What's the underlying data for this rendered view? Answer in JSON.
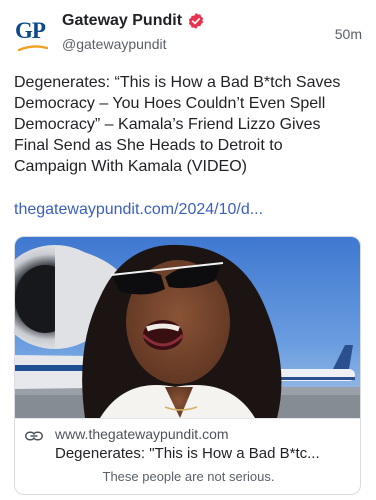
{
  "account": {
    "avatar_text": "GP",
    "display_name": "Gateway Pundit",
    "handle": "@gatewaypundit",
    "verified": true,
    "time_ago": "50m"
  },
  "post": {
    "text": "Degenerates: “This is How a Bad B*tch Saves Democracy – You Hoes Couldn’t Even Spell Democracy” – Kamala’s Friend Lizzo Gives Final Send as She Heads to Detroit to Campaign With Kamala (VIDEO)",
    "link": "thegatewaypundit.com/2024/10/d..."
  },
  "link_card": {
    "domain": "www.thegatewaypundit.com",
    "title": "Degenerates: \"This is How a Bad B*tc...",
    "description": "These people are not serious.",
    "image_alt": "Woman in sunglasses speaking on an airport tarmac next to a jet engine"
  },
  "colors": {
    "link": "#3b5fc0",
    "brand_blue": "#0c4a8c",
    "brand_orange": "#f2a026",
    "verified_badge": "#e8334e"
  },
  "icons": {
    "verified": "verified-badge-icon",
    "link": "link-chain-icon"
  }
}
